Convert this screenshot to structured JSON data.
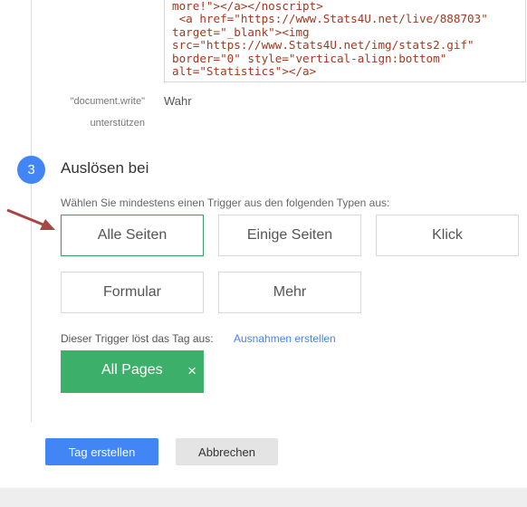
{
  "code": {
    "lines": [
      "more!\"></a></noscript>",
      " <a href=\"https://www.Stats4U.net/live/888703\"",
      "target=\"_blank\"><img",
      "src=\"https://www.Stats4U.net/img/stats2.gif\"",
      "border=\"0\" style=\"vertical-align:bottom\"",
      "alt=\"Statistics\"></a>"
    ]
  },
  "property": {
    "label_line1": "\"document.write\"",
    "label_line2": "unterstützen",
    "value": "Wahr"
  },
  "step": {
    "number": "3",
    "title": "Auslösen bei"
  },
  "hint": "Wählen Sie mindestens einen Trigger aus den folgenden Typen aus:",
  "trigger_types": [
    {
      "label": "Alle Seiten",
      "selected": true
    },
    {
      "label": "Einige Seiten",
      "selected": false
    },
    {
      "label": "Klick",
      "selected": false
    },
    {
      "label": "Formular",
      "selected": false
    },
    {
      "label": "Mehr",
      "selected": false
    }
  ],
  "trigger_info": {
    "text": "Dieser Trigger löst das Tag aus:",
    "link": "Ausnahmen erstellen"
  },
  "chip": {
    "label": "All Pages",
    "close": "×"
  },
  "buttons": {
    "create": "Tag erstellen",
    "cancel": "Abbrechen"
  },
  "colors": {
    "accent": "#4285f4",
    "chip": "#3cb06b",
    "selected_border": "#3a9a6a",
    "code_text": "#a0391f",
    "arrow": "#a84545"
  }
}
